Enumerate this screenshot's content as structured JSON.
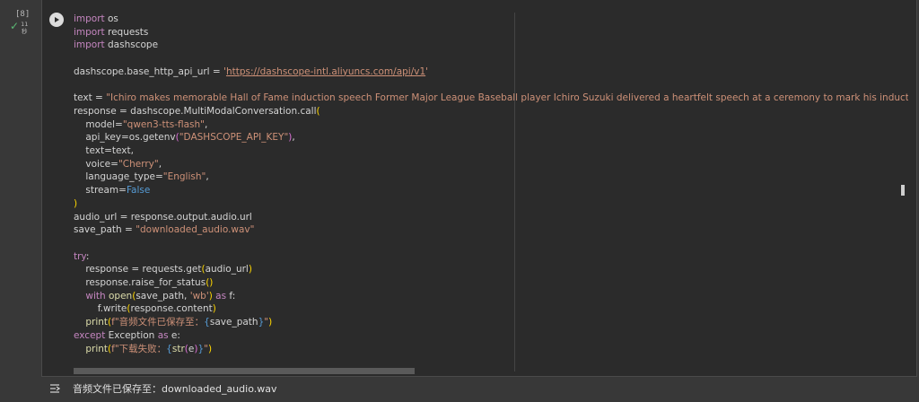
{
  "cell": {
    "execution_count": "[8]",
    "exec_time_value": "11",
    "exec_time_unit": "秒",
    "lines": [
      [
        {
          "c": "kw",
          "t": "import"
        },
        {
          "t": " os"
        }
      ],
      [
        {
          "c": "kw",
          "t": "import"
        },
        {
          "t": " requests"
        }
      ],
      [
        {
          "c": "kw",
          "t": "import"
        },
        {
          "t": " dashscope"
        }
      ],
      [],
      [
        {
          "t": "dashscope.base_http_api_url = "
        },
        {
          "c": "str",
          "t": "'"
        },
        {
          "c": "link",
          "t": "https://dashscope-intl.aliyuncs.com/api/v1"
        },
        {
          "c": "str",
          "t": "'"
        }
      ],
      [],
      [
        {
          "t": "text = "
        },
        {
          "c": "str",
          "t": "\"Ichiro makes memorable Hall of Fame induction speech Former Major League Baseball player Ichiro Suzuki delivered a heartfelt speech at a ceremony to mark his induction in"
        }
      ],
      [
        {
          "t": "response = dashscope.MultiModalConversation.call"
        },
        {
          "c": "br1",
          "t": "("
        }
      ],
      [
        {
          "t": "    model="
        },
        {
          "c": "str",
          "t": "\"qwen3-tts-flash\""
        },
        {
          "t": ","
        }
      ],
      [
        {
          "t": "    api_key=os.getenv"
        },
        {
          "c": "br2",
          "t": "("
        },
        {
          "c": "str",
          "t": "\"DASHSCOPE_API_KEY\""
        },
        {
          "c": "br2",
          "t": ")"
        },
        {
          "t": ","
        }
      ],
      [
        {
          "t": "    text=text,"
        }
      ],
      [
        {
          "t": "    voice="
        },
        {
          "c": "str",
          "t": "\"Cherry\""
        },
        {
          "t": ","
        }
      ],
      [
        {
          "t": "    language_type="
        },
        {
          "c": "str",
          "t": "\"English\""
        },
        {
          "t": ","
        }
      ],
      [
        {
          "t": "    stream="
        },
        {
          "c": "kwc",
          "t": "False"
        }
      ],
      [
        {
          "c": "br1",
          "t": ")"
        }
      ],
      [
        {
          "t": "audio_url = response.output.audio.url"
        }
      ],
      [
        {
          "t": "save_path = "
        },
        {
          "c": "str",
          "t": "\"downloaded_audio.wav\""
        }
      ],
      [],
      [
        {
          "c": "kw",
          "t": "try"
        },
        {
          "t": ":"
        }
      ],
      [
        {
          "t": "    response = requests.get"
        },
        {
          "c": "br1",
          "t": "("
        },
        {
          "t": "audio_url"
        },
        {
          "c": "br1",
          "t": ")"
        }
      ],
      [
        {
          "t": "    response.raise_for_status"
        },
        {
          "c": "br1",
          "t": "()"
        }
      ],
      [
        {
          "t": "    "
        },
        {
          "c": "kw",
          "t": "with"
        },
        {
          "t": " "
        },
        {
          "c": "fn",
          "t": "open"
        },
        {
          "c": "br1",
          "t": "("
        },
        {
          "t": "save_path, "
        },
        {
          "c": "str",
          "t": "'wb'"
        },
        {
          "c": "br1",
          "t": ")"
        },
        {
          "t": " "
        },
        {
          "c": "kw",
          "t": "as"
        },
        {
          "t": " f:"
        }
      ],
      [
        {
          "t": "        f.write"
        },
        {
          "c": "br1",
          "t": "("
        },
        {
          "t": "response.content"
        },
        {
          "c": "br1",
          "t": ")"
        }
      ],
      [
        {
          "t": "    "
        },
        {
          "c": "fn",
          "t": "print"
        },
        {
          "c": "br1",
          "t": "("
        },
        {
          "c": "str",
          "t": "f\"音频文件已保存至："
        },
        {
          "c": "kwc",
          "t": "{"
        },
        {
          "t": "save_path"
        },
        {
          "c": "kwc",
          "t": "}"
        },
        {
          "c": "str",
          "t": "\""
        },
        {
          "c": "br1",
          "t": ")"
        }
      ],
      [
        {
          "c": "kw",
          "t": "except"
        },
        {
          "t": " Exception "
        },
        {
          "c": "kw",
          "t": "as"
        },
        {
          "t": " e:"
        }
      ],
      [
        {
          "t": "    "
        },
        {
          "c": "fn",
          "t": "print"
        },
        {
          "c": "br1",
          "t": "("
        },
        {
          "c": "str",
          "t": "f\"下载失败："
        },
        {
          "c": "kwc",
          "t": "{"
        },
        {
          "c": "fn",
          "t": "str"
        },
        {
          "c": "br2",
          "t": "("
        },
        {
          "t": "e"
        },
        {
          "c": "br2",
          "t": ")"
        },
        {
          "c": "kwc",
          "t": "}"
        },
        {
          "c": "str",
          "t": "\""
        },
        {
          "c": "br1",
          "t": ")"
        }
      ]
    ]
  },
  "output": {
    "text": "音频文件已保存至：downloaded_audio.wav"
  },
  "colors": {
    "keyword": "#c586c0",
    "string": "#ce9178",
    "constant": "#569cd6",
    "function": "#dcdcaa",
    "bracket_level1": "#ffd700",
    "bracket_level2": "#da70d6",
    "success": "#5bb974"
  },
  "icons": {
    "run": "play-circle-icon",
    "status": "check-icon",
    "output": "output-toggle-icon"
  }
}
